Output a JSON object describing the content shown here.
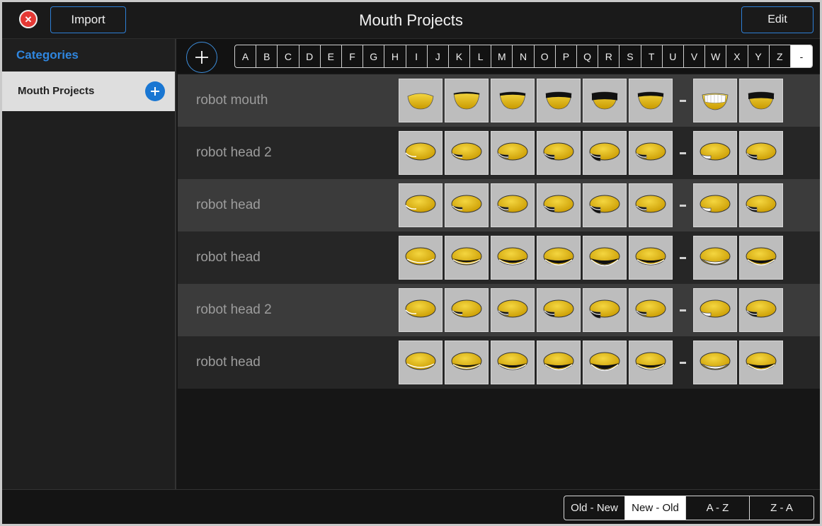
{
  "header": {
    "title": "Mouth Projects",
    "import_label": "Import",
    "edit_label": "Edit",
    "close_icon": "close-icon"
  },
  "sidebar": {
    "header": "Categories",
    "items": [
      {
        "label": "Mouth Projects",
        "selected": true
      }
    ]
  },
  "index_bar": {
    "letters": [
      "A",
      "B",
      "C",
      "D",
      "E",
      "F",
      "G",
      "H",
      "I",
      "J",
      "K",
      "L",
      "M",
      "N",
      "O",
      "P",
      "Q",
      "R",
      "S",
      "T",
      "U",
      "V",
      "W",
      "X",
      "Y",
      "Z",
      "-"
    ],
    "active": "-"
  },
  "projects": [
    {
      "name": "robot mouth",
      "kind": "mouth"
    },
    {
      "name": "robot head 2",
      "kind": "head2"
    },
    {
      "name": "robot head",
      "kind": "headA"
    },
    {
      "name": "robot head",
      "kind": "headB"
    },
    {
      "name": "robot head 2",
      "kind": "head2b"
    },
    {
      "name": "robot head",
      "kind": "headC"
    }
  ],
  "sort": {
    "options": [
      "Old - New",
      "New - Old",
      "A - Z",
      "Z - A"
    ],
    "active": "New - Old"
  },
  "colors": {
    "accent": "#2f86df",
    "mouth_yellow": "#e0b800",
    "close_red": "#e53935"
  }
}
